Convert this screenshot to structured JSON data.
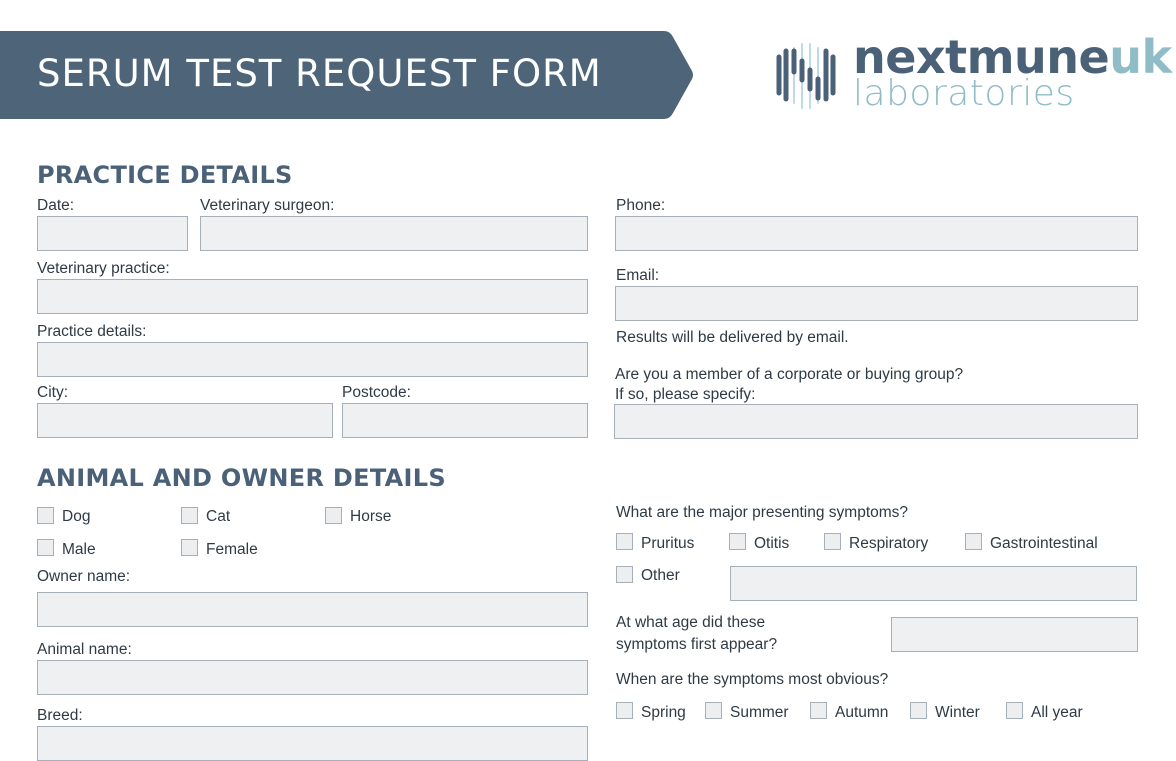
{
  "header": {
    "title": "SERUM TEST REQUEST FORM",
    "banner_color": "#4e6579",
    "logo": {
      "brand_main": "nextmune",
      "brand_suffix": "uk",
      "subtitle": "laboratories"
    }
  },
  "practice": {
    "heading": "PRACTICE DETAILS",
    "date_label": "Date:",
    "date_value": "",
    "surgeon_label": "Veterinary surgeon:",
    "surgeon_value": "",
    "practice_label": "Veterinary practice:",
    "practice_value": "",
    "details_label": "Practice details:",
    "details_value": "",
    "city_label": "City:",
    "city_value": "",
    "postcode_label": "Postcode:",
    "postcode_value": "",
    "phone_label": "Phone:",
    "phone_value": "",
    "email_label": "Email:",
    "email_value": "",
    "email_note": "Results will be delivered by email.",
    "group_question": "Are you a member of a corporate or buying group?",
    "group_prompt": "If so, please specify:",
    "group_value": ""
  },
  "animal": {
    "heading": "ANIMAL AND OWNER DETAILS",
    "species": [
      "Dog",
      "Cat",
      "Horse"
    ],
    "sex": [
      "Male",
      "Female"
    ],
    "owner_label": "Owner name:",
    "owner_value": "",
    "animal_label": "Animal name:",
    "animal_value": "",
    "breed_label": "Breed:",
    "breed_value": ""
  },
  "symptoms": {
    "question": "What are the major presenting symptoms?",
    "options": [
      "Pruritus",
      "Otitis",
      "Respiratory",
      "Gastrointestinal"
    ],
    "other_label": "Other",
    "other_value": "",
    "age_question_line1": "At what age did these",
    "age_question_line2": "symptoms first appear?",
    "age_value": "",
    "season_question": "When are the symptoms most obvious?",
    "seasons": [
      "Spring",
      "Summer",
      "Autumn",
      "Winter",
      "All year"
    ]
  }
}
